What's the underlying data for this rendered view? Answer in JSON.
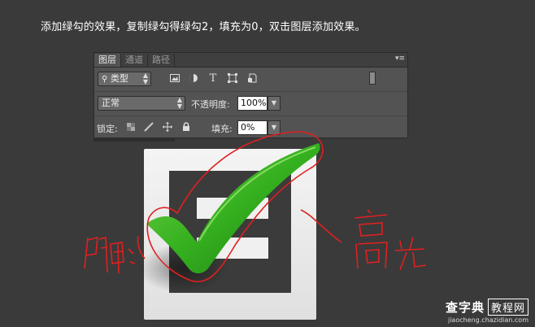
{
  "instruction": "添加绿勾的效果，复制绿勾得绿勾2，填充为0，双击图层添加效果。",
  "layers_panel": {
    "tabs": [
      {
        "label": "图层",
        "active": true
      },
      {
        "label": "通道",
        "active": false
      },
      {
        "label": "路径",
        "active": false
      }
    ],
    "filter": {
      "value": "类型"
    },
    "filter_icons": [
      "image-filter-icon",
      "adjustment-filter-icon",
      "text-filter-icon",
      "shape-filter-icon",
      "smart-object-filter-icon"
    ],
    "blend_mode": "正常",
    "opacity": {
      "label": "不透明度:",
      "value": "100%"
    },
    "lock": {
      "label": "锁定:",
      "icons": [
        "lock-transparent-icon",
        "lock-paint-icon",
        "lock-position-icon",
        "lock-all-icon"
      ]
    },
    "fill": {
      "label": "填充:",
      "value": "0%"
    }
  },
  "annotations": {
    "left": "阴影",
    "right": "高光"
  },
  "colors": {
    "background": "#3a3a3a",
    "checkmark_green": "#35b01f",
    "annotation_red": "#e02020",
    "panel": "#535353"
  },
  "watermark": {
    "site": "查字典",
    "tag": "教程网",
    "url": "jiaocheng.chazidian.com"
  }
}
